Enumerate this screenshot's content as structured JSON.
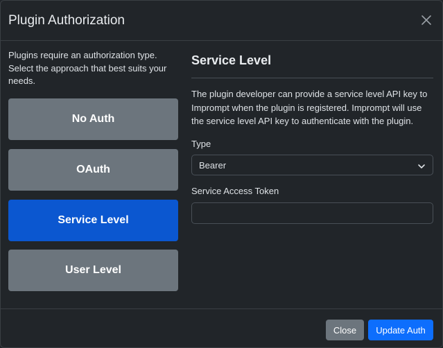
{
  "dialog": {
    "title": "Plugin Authorization"
  },
  "intro_text": "Plugins require an authorization type. Select the approach that best suits your needs.",
  "auth_options": [
    {
      "label": "No Auth",
      "selected": false
    },
    {
      "label": "OAuth",
      "selected": false
    },
    {
      "label": "Service Level",
      "selected": true
    },
    {
      "label": "User Level",
      "selected": false
    }
  ],
  "detail": {
    "title": "Service Level",
    "description": "The plugin developer can provide a service level API key to Imprompt when the plugin is registered. Imprompt will use the service level API key to authenticate with the plugin.",
    "type_label": "Type",
    "type_value": "Bearer",
    "token_label": "Service Access Token",
    "token_value": ""
  },
  "footer": {
    "close_label": "Close",
    "update_label": "Update Auth"
  },
  "colors": {
    "background": "#212529",
    "selected": "#0b57d0",
    "unselected": "#6c757d",
    "primary": "#0d6efd"
  }
}
